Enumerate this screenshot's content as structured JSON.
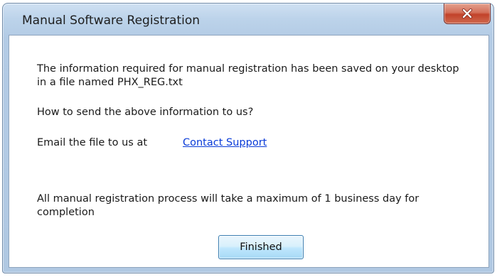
{
  "window": {
    "title": "Manual Software Registration",
    "close_icon": "close-icon"
  },
  "content": {
    "message_saved": "The information required for manual registration has been saved on your desktop in a file named PHX_REG.txt",
    "question": "How to send the above information to us?",
    "email_label": "Email the file  to us at",
    "contact_link": "Contact Support",
    "completion_note": "All manual registration process will take a maximum of 1 business day for completion"
  },
  "buttons": {
    "finished": "Finished"
  },
  "colors": {
    "link": "#0a3cd8",
    "close_button": "#c2422a"
  }
}
